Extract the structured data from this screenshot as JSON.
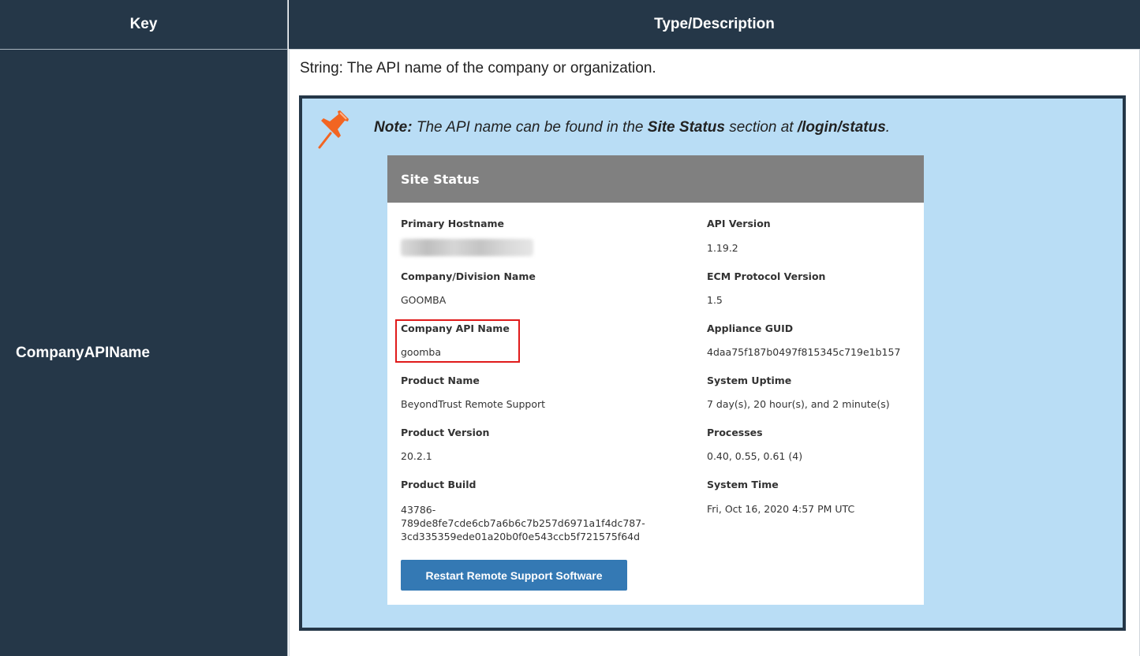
{
  "table": {
    "header": {
      "key": "Key",
      "description": "Type/Description"
    },
    "row": {
      "key": "CompanyAPIName",
      "description": "String: The API name of the company or organization."
    }
  },
  "note": {
    "label": "Note:",
    "text_1": " The API name can be found in the ",
    "bold_1": "Site Status",
    "text_2": " section at ",
    "bold_2": "/login/status",
    "text_3": "."
  },
  "site_status": {
    "title": "Site Status",
    "left": {
      "primary_hostname_label": "Primary Hostname",
      "company_division_label": "Company/Division Name",
      "company_division_value": "GOOMBA",
      "company_api_label": "Company API Name",
      "company_api_value": "goomba",
      "product_name_label": "Product Name",
      "product_name_value": "BeyondTrust Remote Support",
      "product_version_label": "Product Version",
      "product_version_value": "20.2.1",
      "product_build_label": "Product Build",
      "product_build_line1": "43786-",
      "product_build_line2": "789de8fe7cde6cb7a6b6c7b257d6971a1f4dc787-",
      "product_build_line3": "3cd335359ede01a20b0f0e543ccb5f721575f64d"
    },
    "right": {
      "api_version_label": "API Version",
      "api_version_value": "1.19.2",
      "ecm_label": "ECM Protocol Version",
      "ecm_value": "1.5",
      "guid_label": "Appliance GUID",
      "guid_value": "4daa75f187b0497f815345c719e1b157",
      "uptime_label": "System Uptime",
      "uptime_value": "7 day(s), 20 hour(s), and 2 minute(s)",
      "processes_label": "Processes",
      "processes_value": "0.40, 0.55, 0.61 (4)",
      "time_label": "System Time",
      "time_value": "Fri, Oct 16, 2020 4:57 PM UTC"
    },
    "restart_button": "Restart Remote Support Software"
  },
  "icons": {
    "pin": "pushpin-icon"
  },
  "colors": {
    "header_bg": "#253748",
    "note_bg": "#b9ddf5",
    "pin": "#f26522",
    "highlight": "#e01b1b",
    "button": "#3479b4"
  }
}
